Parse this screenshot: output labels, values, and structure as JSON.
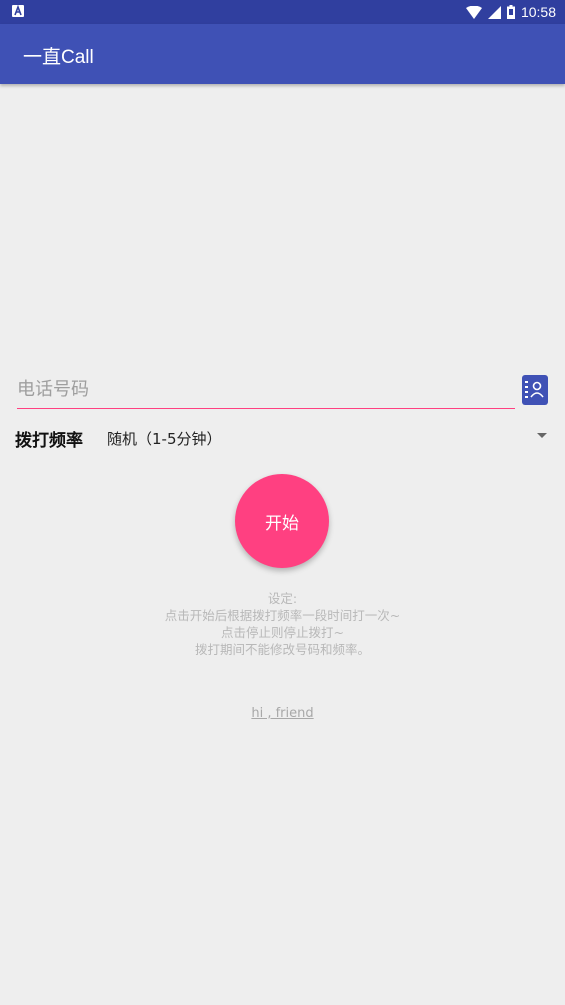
{
  "status_bar": {
    "time": "10:58"
  },
  "app_bar": {
    "title": "一直Call"
  },
  "phone": {
    "placeholder": "电话号码",
    "value": ""
  },
  "frequency": {
    "label": "拨打频率",
    "selected": "随机（1-5分钟）"
  },
  "start_button": {
    "label": "开始"
  },
  "description": {
    "lines": [
      "设定:",
      "点击开始后根据拨打频率一段时间打一次~",
      "点击停止则停止拨打~",
      "拨打期间不能修改号码和频率。"
    ]
  },
  "footer": {
    "link": "hi , friend"
  },
  "colors": {
    "primary": "#3f51b5",
    "primary_dark": "#303f9f",
    "accent": "#ff4081",
    "background": "#eeeeee"
  }
}
